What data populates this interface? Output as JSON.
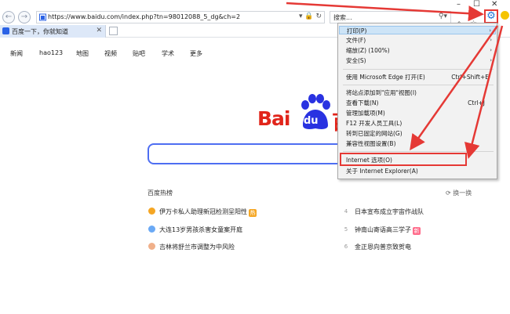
{
  "browser": {
    "url": "https://www.baidu.com/index.php?tn=98012088_5_dg&ch=2",
    "search_placeholder": "搜索...",
    "tab_title": "百度一下，你就知道"
  },
  "baidu": {
    "nav": [
      "新闻",
      "hao123",
      "地图",
      "视频",
      "贴吧",
      "学术",
      "更多"
    ],
    "logo_text_left": "Bai",
    "logo_text_du": "du",
    "logo_text_right": "百",
    "hot_title": "百度热榜",
    "refresh": "换一换",
    "hot_left": [
      {
        "rank": "",
        "text": "伊万卡私人助理新冠检测呈阳性",
        "badge": "热",
        "badge_color": "#f5a623"
      },
      {
        "rank": "",
        "text": "大连13岁男孩杀害女童案开庭",
        "badge": "",
        "badge_color": ""
      },
      {
        "rank": "",
        "text": "吉林将舒兰市调整为中风险",
        "badge": "",
        "badge_color": ""
      }
    ],
    "hot_right": [
      {
        "rank": "4",
        "text": "日本宣布成立宇宙作战队",
        "badge": "",
        "badge_color": ""
      },
      {
        "rank": "5",
        "text": "钟南山寄语高三学子",
        "badge": "新",
        "badge_color": "#ff6b8a"
      },
      {
        "rank": "6",
        "text": "金正恩向普京致贺电",
        "badge": "",
        "badge_color": ""
      }
    ]
  },
  "menu": {
    "items": [
      {
        "label": "打印(P)",
        "shortcut": "",
        "submenu": true,
        "highlighted": true
      },
      {
        "label": "文件(F)",
        "shortcut": "",
        "submenu": true,
        "highlighted": false
      },
      {
        "label": "缩放(Z) (100%)",
        "shortcut": "",
        "submenu": true,
        "highlighted": false
      },
      {
        "label": "安全(S)",
        "shortcut": "",
        "submenu": true,
        "highlighted": false
      },
      {
        "label": "使用 Microsoft Edge 打开(E)",
        "shortcut": "Ctrl+Shift+E",
        "submenu": false,
        "highlighted": false
      },
      {
        "label": "将站点添加到\"应用\"视图(I)",
        "shortcut": "",
        "submenu": false,
        "highlighted": false
      },
      {
        "label": "查看下载(N)",
        "shortcut": "Ctrl+J",
        "submenu": false,
        "highlighted": false
      },
      {
        "label": "管理加载项(M)",
        "shortcut": "",
        "submenu": false,
        "highlighted": false
      },
      {
        "label": "F12 开发人员工具(L)",
        "shortcut": "",
        "submenu": false,
        "highlighted": false
      },
      {
        "label": "转到已固定的网站(G)",
        "shortcut": "",
        "submenu": false,
        "highlighted": false
      },
      {
        "label": "兼容性视图设置(B)",
        "shortcut": "",
        "submenu": false,
        "highlighted": false
      },
      {
        "label": "Internet 选项(O)",
        "shortcut": "",
        "submenu": false,
        "highlighted": false
      },
      {
        "label": "关于 Internet Explorer(A)",
        "shortcut": "",
        "submenu": false,
        "highlighted": false
      }
    ]
  },
  "colors": {
    "annotation_red": "#e53935",
    "baidu_red": "#e1251b",
    "baidu_blue": "#2932e1",
    "search_border": "#4e6ef2"
  }
}
